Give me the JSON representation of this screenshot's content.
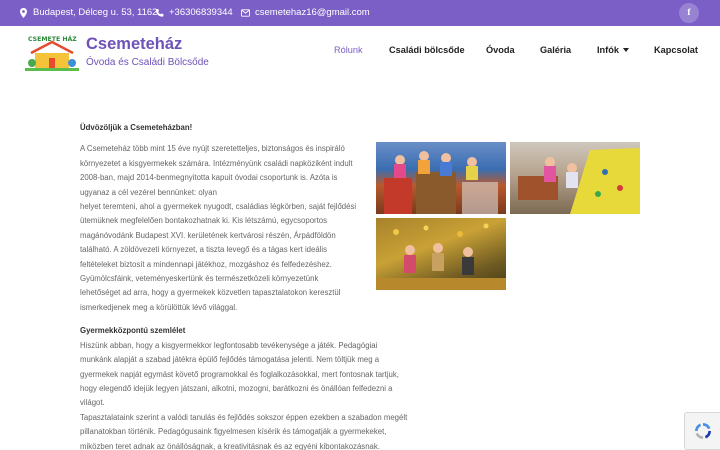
{
  "topbar": {
    "address": "Budapest, Délceg u. 53, 1162",
    "phone": "+36306839344",
    "email": "csemetehaz16@gmail.com",
    "social": "f"
  },
  "header": {
    "logo_text": "CSEMETE HÁZ",
    "brand_name": "Csemeteház",
    "brand_sub": "Óvoda és Családi Bölcsőde",
    "nav": [
      "Rólunk",
      "Családi bölcsőde",
      "Óvoda",
      "Galéria",
      "Infók",
      "Kapcsolat"
    ]
  },
  "content": {
    "welcome": "Üdvözöljük a Csemeteházban!",
    "para1": [
      "A Csemeteház több mint 15 éve nyújt szeretetteljes, biztonságos és inspiráló",
      "környezetet a kisgyermekek számára. Intézményünk családi napköziként indult",
      "2008-ban, majd 2014-benmegnyitotta kapuit óvodai csoportunk is. Azóta is",
      "ugyanaz a cél vezérel bennünket: olyan",
      "helyet teremteni, ahol a gyermekek nyugodt, családias légkörben, saját fejlődési",
      "ütemüknek megfelelően bontakozhatnak ki. Kis létszámú, egycsoportos",
      "magánóvodánk Budapest XVI. kerületének kertvárosi részén, Árpádföldön",
      "található. A zöldövezeti környezet, a tiszta levegő és a tágas kert ideális",
      "feltételeket biztosít a mindennapi játékhoz, mozgáshoz és felfedezéshez.",
      "Gyümölcsfáink, veteményeskertünk és természetközeli környezetünk",
      "lehetőséget ad arra, hogy a gyermekek közvetlen tapasztalatokon keresztül",
      "ismerkedjenek meg a körülöttük lévő világgal."
    ],
    "sub_title": "Gyermekközpontú szemlélet",
    "para2": [
      "Hiszünk abban, hogy a kisgyermekkor legfontosabb tevékenysége a játék. Pedagógiai",
      "munkánk alapját a szabad játékra épülő fejlődés támogatása jelenti. Nem töltjük meg a",
      "gyermekek napját egymást követő programokkal és foglalkozásokkal, mert fontosnak tartjuk,",
      "hogy elegendő idejük legyen játszani, alkotni, mozogni, barátkozni és önállóan felfedezni a",
      "világot.",
      "Tapasztalataink szerint a valódi tanulás és fejlődés sokszor éppen ezekben a szabadon megélt",
      "pillanatokban történik. Pedagógusaink figyelmesen kísérik és támogatják a gyermekeket,",
      "miközben teret adnak az önállóságnak, a kreativitásnak és az egyéni kibontakozásnak."
    ]
  },
  "colors": {
    "accent": "#7b5fc6",
    "text": "#666666"
  }
}
